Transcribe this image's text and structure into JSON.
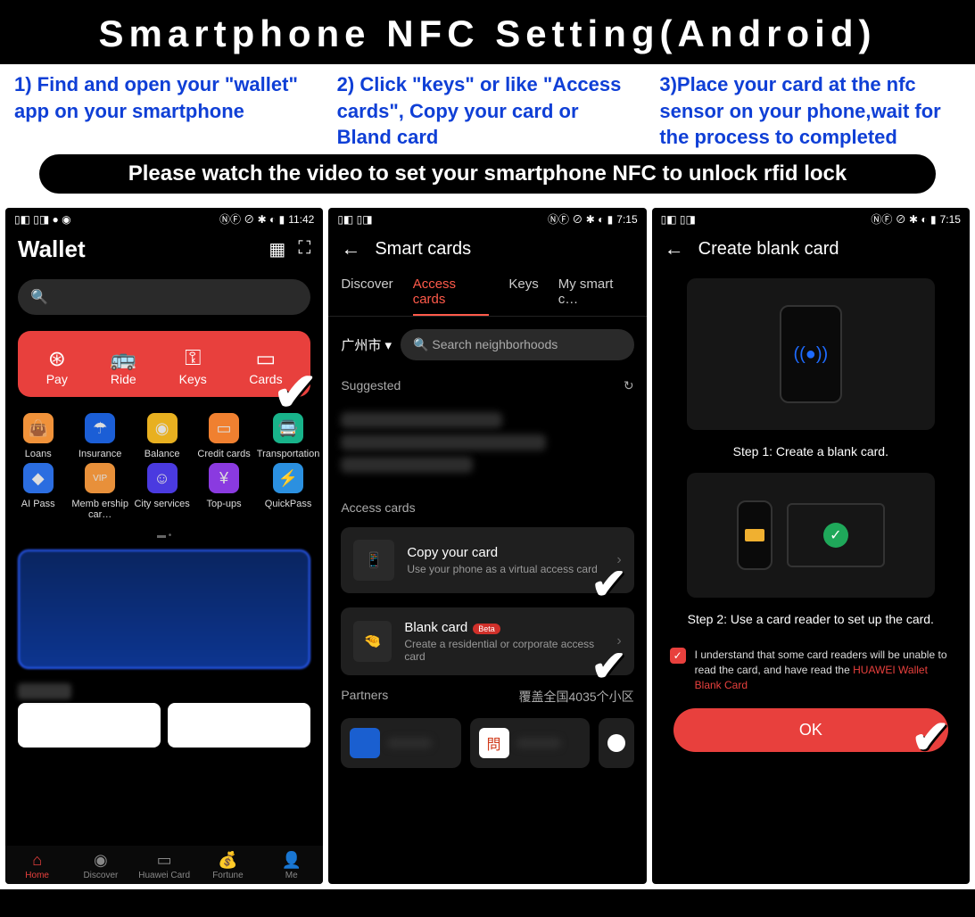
{
  "title": "Smartphone NFC Setting(Android)",
  "instructions": {
    "i1": "1) Find and open your \"wallet\" app on your smartphone",
    "i2": "2) Click \"keys\" or like \"Access cards\", Copy your card or Bland card",
    "i3": "3)Place your card at the nfc sensor on your phone,wait for the process to completed"
  },
  "banner": "Please watch the video to set your smartphone NFC to unlock rfid lock",
  "phone1": {
    "time": "11:42",
    "title": "Wallet",
    "red_items": [
      "Pay",
      "Ride",
      "Keys",
      "Cards"
    ],
    "grid1": [
      "Loans",
      "Insurance",
      "Balance",
      "Credit cards",
      "Transportation"
    ],
    "grid2": [
      "AI Pass",
      "Memb ership car…",
      "City services",
      "Top-ups",
      "QuickPass"
    ],
    "nav": [
      "Home",
      "Discover",
      "Huawei Card",
      "Fortune",
      "Me"
    ]
  },
  "phone2": {
    "time": "7:15",
    "title": "Smart cards",
    "tabs": [
      "Discover",
      "Access cards",
      "Keys",
      "My smart c…"
    ],
    "city": "广州市",
    "search_ph": "Search neighborhoods",
    "suggested": "Suggested",
    "access_label": "Access cards",
    "copy_title": "Copy your card",
    "copy_sub": "Use your phone as a virtual access card",
    "blank_title": "Blank card",
    "blank_badge": "Beta",
    "blank_sub": "Create a residential or corporate access card",
    "partners": "Partners",
    "partners_cov": "覆盖全国4035个小区"
  },
  "phone3": {
    "time": "7:15",
    "title": "Create blank card",
    "step1": "Step 1: Create a blank card.",
    "step2": "Step 2: Use a card reader to set up the card.",
    "consent": "I understand that some card readers will be unable to read the card, and have read the ",
    "consent_link": "HUAWEI Wallet Blank Card",
    "ok": "OK"
  }
}
